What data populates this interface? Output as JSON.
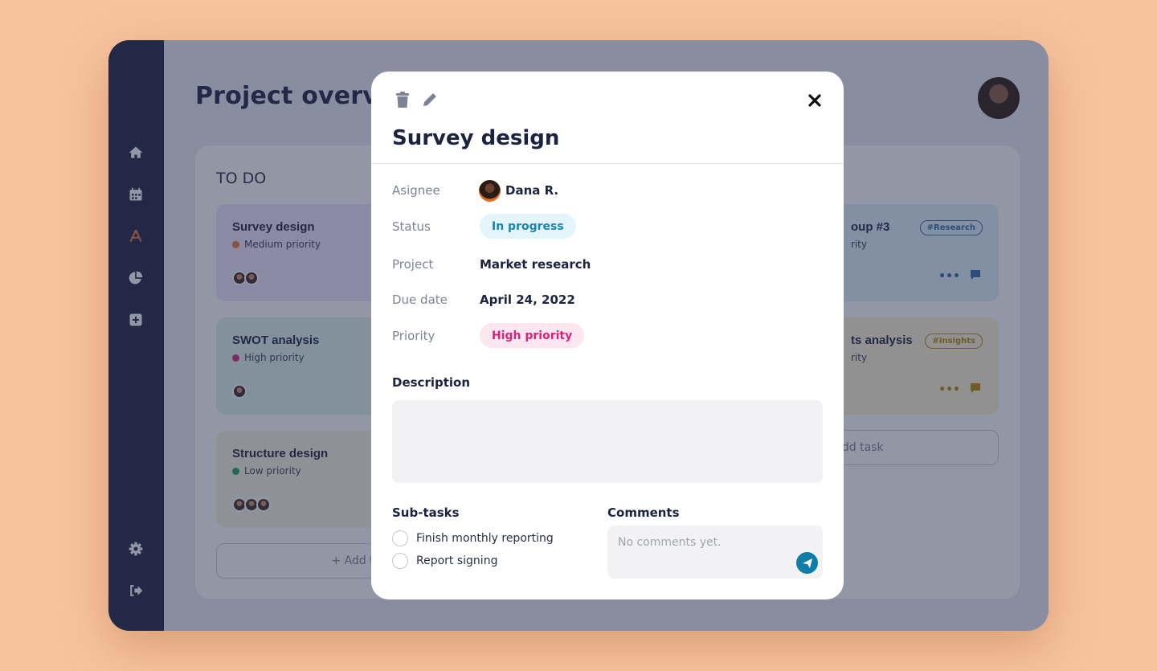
{
  "app": {
    "page_title": "Project overview"
  },
  "sidebar": {
    "items": [
      {
        "icon": "home-icon"
      },
      {
        "icon": "calendar-icon"
      },
      {
        "icon": "tools-icon"
      },
      {
        "icon": "pie-chart-icon"
      },
      {
        "icon": "plus-square-icon"
      }
    ],
    "bottom": [
      {
        "icon": "gear-icon"
      },
      {
        "icon": "logout-icon"
      }
    ],
    "accent": "#e8783a"
  },
  "board": {
    "todo_title": "TO DO",
    "todo_cards": [
      {
        "title": "Survey design",
        "priority": "Medium priority",
        "dot": "#e8783a",
        "bg": "#ece6ff"
      },
      {
        "title": "SWOT analysis",
        "priority": "High priority",
        "dot": "#d6247a",
        "bg": "#dff5ee"
      },
      {
        "title": "Structure design",
        "priority": "Low priority",
        "dot": "#22a06b",
        "bg": "#f4f7e4"
      }
    ],
    "right_cards": [
      {
        "title": "oup #3",
        "priority": "rity",
        "tag": "#Research",
        "tag_color": "#2f6fa8",
        "bg": "#dff0fb"
      },
      {
        "title": "ts analysis",
        "priority": "rity",
        "tag": "#Insights",
        "tag_color": "#b58a00",
        "bg": "#fbf4d8"
      }
    ],
    "add_task": "+ Add task"
  },
  "modal": {
    "title": "Survey design",
    "fields": {
      "assignee_label": "Asignee",
      "assignee_value": "Dana R.",
      "status_label": "Status",
      "status_value": "In progress",
      "project_label": "Project",
      "project_value": "Market research",
      "due_label": "Due date",
      "due_value": "April 24, 2022",
      "priority_label": "Priority",
      "priority_value": "High priority"
    },
    "description_label": "Description",
    "subtasks_label": "Sub-tasks",
    "subtasks": [
      "Finish monthly reporting",
      "Report signing"
    ],
    "comments_label": "Comments",
    "comments_placeholder": "No comments yet.",
    "colors": {
      "status_bg": "#e3f4fb",
      "status_text": "#1585b3",
      "priority_bg": "#fde6ef",
      "priority_text": "#d6247a",
      "send": "#0e7da8"
    }
  }
}
